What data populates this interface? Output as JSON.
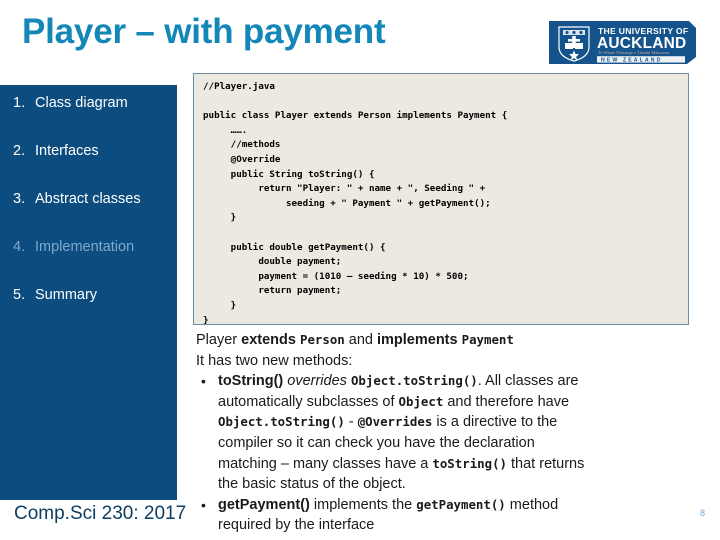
{
  "slide": {
    "title": "Player – with payment",
    "page_number": "8",
    "footer": "Comp.Sci 230: 2017"
  },
  "logo": {
    "name": "university-of-auckland-logo",
    "line1": "THE UNIVERSITY OF",
    "line2": "AUCKLAND",
    "line3": "Te Whare Wānanga o Tāmaki Makaurau",
    "line4": "N E W   Z E A L A N D",
    "bg_color": "#14538b",
    "text_color": "#ffffff"
  },
  "sidebar": {
    "bg_color": "#0c4c7f",
    "active_color": "#7ea9cf",
    "items": [
      {
        "num": "1.",
        "label": "Class diagram",
        "active": false
      },
      {
        "num": "2.",
        "label": "Interfaces",
        "active": false
      },
      {
        "num": "3.",
        "label": "Abstract classes",
        "active": false
      },
      {
        "num": "4.",
        "label": "Implementation",
        "active": true
      },
      {
        "num": "5.",
        "label": "Summary",
        "active": false
      }
    ]
  },
  "code_box": {
    "bg_color": "#eceae0",
    "border_color": "#6d8ca6",
    "filename_comment": "//Player.java",
    "code": "//Player.java\n\npublic class Player extends Person implements Payment {\n     …….\n     //methods\n     @Override\n     public String toString() {\n          return \"Player: \" + name + \", Seeding \" +\n               seeding + \" Payment \" + getPayment();\n     }\n\n     public double getPayment() {\n          double payment;\n          payment = (1010 – seeding * 10) * 500;\n          return payment;\n     }\n}"
  },
  "body": {
    "line1": {
      "t1": "Player ",
      "kw1": "extends ",
      "mono1": "Person",
      "t2": " and ",
      "kw2": "implements ",
      "mono2": "Payment"
    },
    "line2": "It has two new methods:",
    "bullet1": {
      "marker": "•",
      "kw1": "toString()",
      "italic1": " overrides ",
      "mono1": "Object.toString()",
      "t1": ". All classes are",
      "t2": "automatically subclasses of ",
      "mono2": "Object",
      "t3": " and therefore have",
      "mono3": "Object.toString()",
      "t4": " - ",
      "mono4": "@Overrides",
      "t5": " is a directive to the",
      "t6": "compiler so it can check you have the declaration",
      "t7": "matching – many classes have a ",
      "mono5": "toString()",
      "t8": " that returns",
      "t9": "the basic status of the object."
    },
    "bullet2": {
      "marker": "•",
      "kw1": "getPayment()",
      "t1": " implements the ",
      "mono1": "getPayment()",
      "t2": " method",
      "t3": "required by the interface"
    }
  }
}
